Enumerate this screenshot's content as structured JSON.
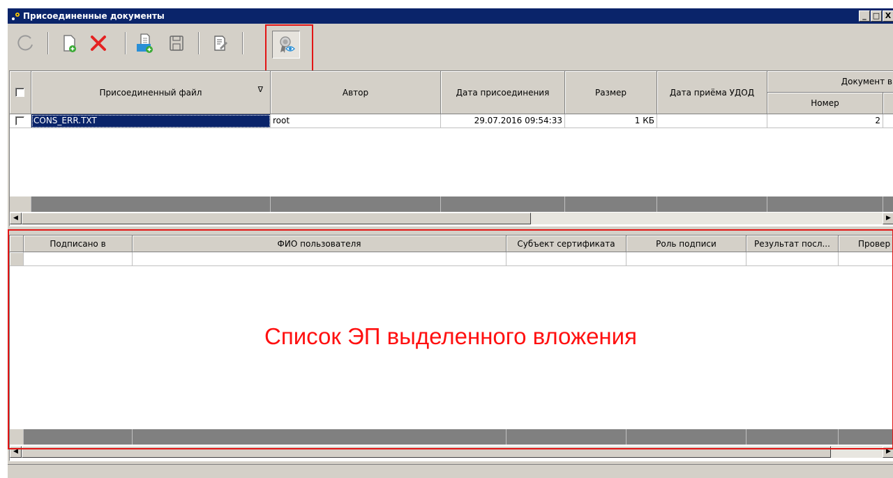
{
  "window": {
    "title": "Присоединенные документы",
    "controls": {
      "minimize": "_",
      "maximize": "□",
      "close": "X"
    }
  },
  "toolbar": {
    "buttons": [
      {
        "name": "refresh",
        "icon": "refresh-icon"
      },
      {
        "name": "add-document",
        "icon": "new-document-icon"
      },
      {
        "name": "delete",
        "icon": "delete-icon"
      },
      {
        "name": "attach",
        "icon": "attach-document-icon"
      },
      {
        "name": "save",
        "icon": "save-icon"
      },
      {
        "name": "edit",
        "icon": "edit-document-icon"
      },
      {
        "name": "view-signatures",
        "icon": "certificate-view-icon",
        "pressed": true,
        "highlighted": true
      }
    ]
  },
  "documents_table": {
    "columns": {
      "file": "Присоединенный файл",
      "author": "Автор",
      "attached_date": "Дата присоединения",
      "size": "Размер",
      "udod_date": "Дата приёма УДОД",
      "doc_group": "Документ в",
      "number": "Номер"
    },
    "sort_indicator": "∇",
    "rows": [
      {
        "file": "CONS_ERR.TXT",
        "author": "root",
        "attached_date": "29.07.2016 09:54:33",
        "size": "1 КБ",
        "udod_date": "",
        "number": "2",
        "selected": true
      }
    ]
  },
  "signatures_table": {
    "columns": {
      "signed_in": "Подписано в",
      "user_fio": "ФИО пользователя",
      "cert_subject": "Субъект сертификата",
      "sign_role": "Роль подписи",
      "last_result": "Результат посл...",
      "check": "Провер"
    },
    "rows": []
  },
  "annotation": {
    "caption": "Список ЭП выделенного вложения",
    "color": "#ff1010"
  },
  "colors": {
    "titlebar": "#0a246a",
    "window_bg": "#d4d0c8",
    "highlight_border": "#e21515"
  }
}
